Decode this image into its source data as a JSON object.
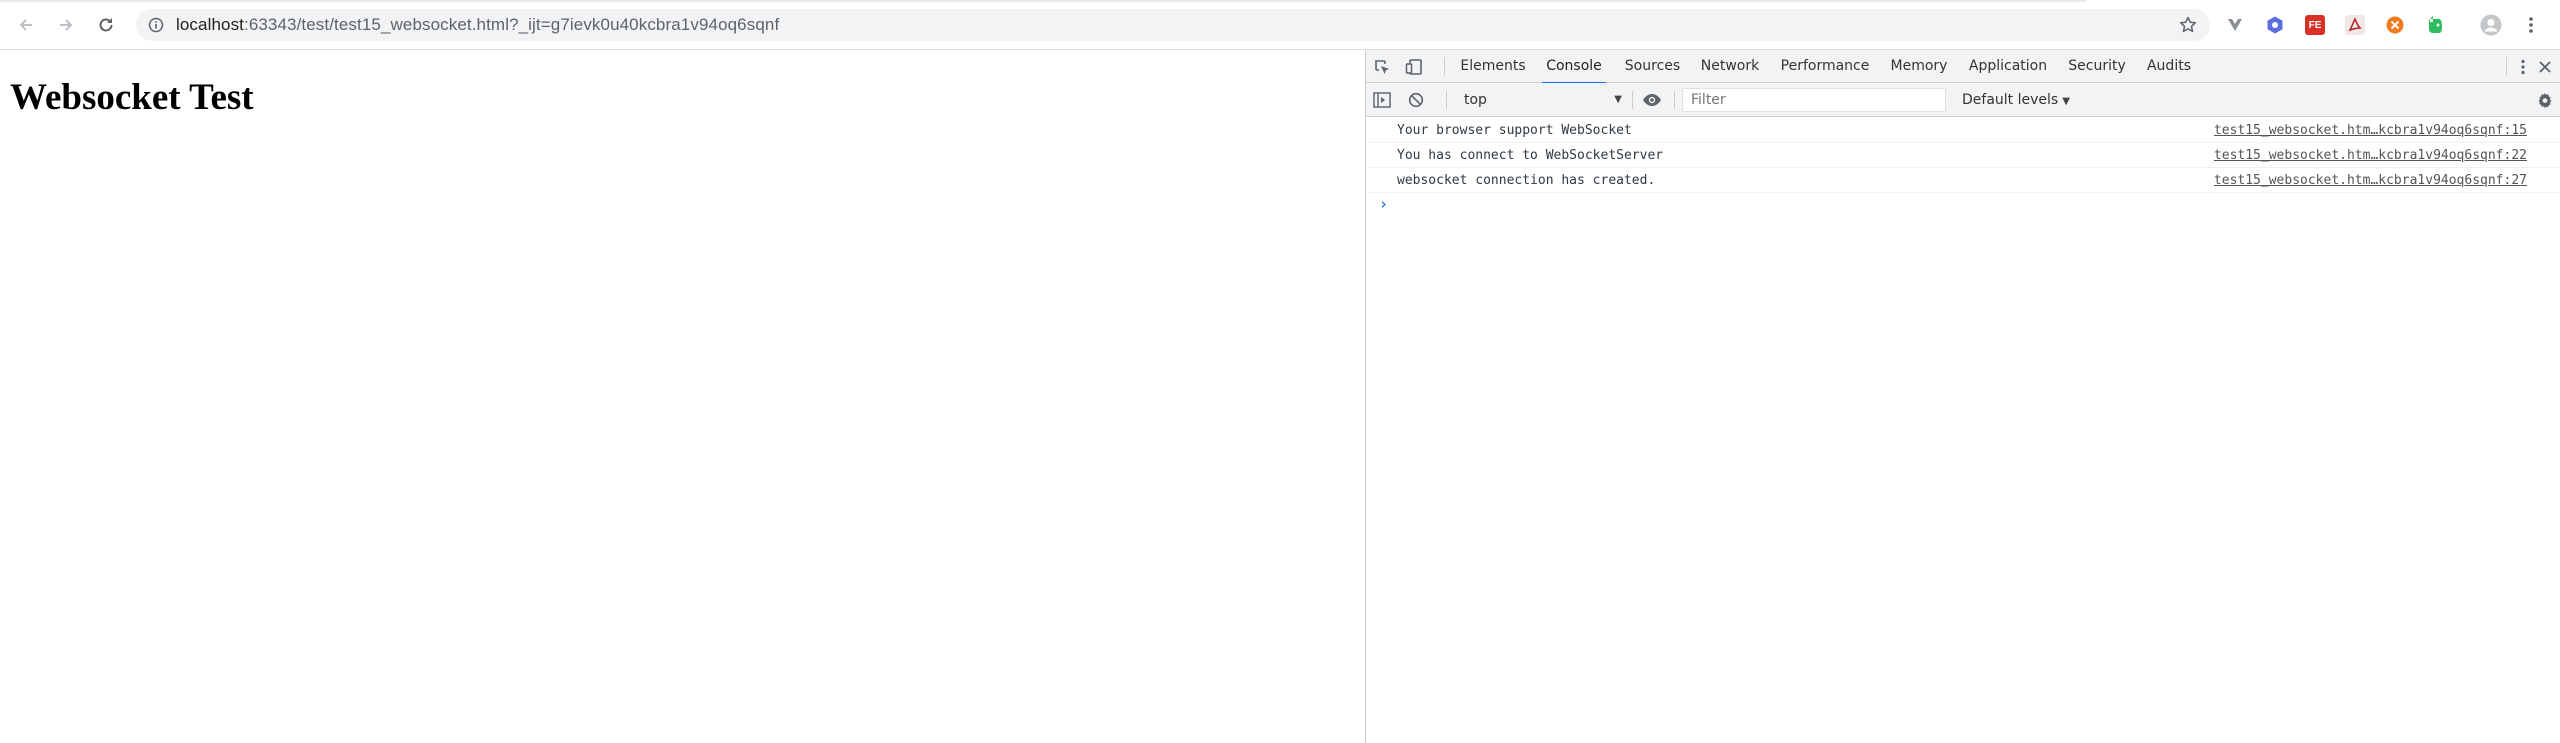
{
  "browser": {
    "url_host": "localhost",
    "url_rest": ":63343/test/test15_websocket.html?_ijt=g7ievk0u40kcbra1v94oq6sqnf",
    "extensions": [
      {
        "name": "vue-devtools",
        "icon": "v-chevron-icon",
        "color": "#5f6368"
      },
      {
        "name": "react-devtools",
        "icon": "hex-icon",
        "color": "#5b6ee1"
      },
      {
        "name": "fehelper",
        "label": "FE",
        "color": "#d93025"
      },
      {
        "name": "acrobat",
        "icon": "acrobat-icon",
        "color": "#b22222"
      },
      {
        "name": "orange-ext",
        "icon": "circle-x-icon",
        "color": "#f07b1f"
      },
      {
        "name": "evernote",
        "icon": "evernote-icon",
        "color": "#2dbe60"
      }
    ]
  },
  "page": {
    "heading": "Websocket Test"
  },
  "devtools": {
    "tabs": [
      {
        "label": "Elements",
        "active": false
      },
      {
        "label": "Console",
        "active": true
      },
      {
        "label": "Sources",
        "active": false
      },
      {
        "label": "Network",
        "active": false
      },
      {
        "label": "Performance",
        "active": false
      },
      {
        "label": "Memory",
        "active": false
      },
      {
        "label": "Application",
        "active": false
      },
      {
        "label": "Security",
        "active": false
      },
      {
        "label": "Audits",
        "active": false
      }
    ],
    "console_toolbar": {
      "context": "top",
      "filter_placeholder": "Filter",
      "levels": "Default levels"
    },
    "logs": [
      {
        "message": "Your browser support WebSocket",
        "source": "test15_websocket.htm…kcbra1v94oq6sqnf:15"
      },
      {
        "message": "You has connect to WebSocketServer",
        "source": "test15_websocket.htm…kcbra1v94oq6sqnf:22"
      },
      {
        "message": "websocket connection has created.",
        "source": "test15_websocket.htm…kcbra1v94oq6sqnf:27"
      }
    ],
    "accent_color": "#1a73e8"
  }
}
